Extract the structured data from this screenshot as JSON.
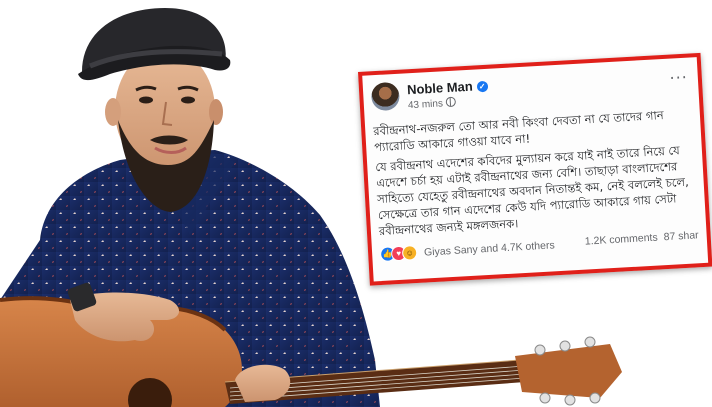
{
  "post": {
    "author": "Noble Man",
    "time": "43 mins",
    "more_icon": "more-horizontal-icon",
    "paragraph_1": "রবীন্দ্রনাথ-নজরুল তো আর নবী কিংবা দেবতা না যে তাদের গান প্যারোডি আকারে গাওয়া যাবে না!",
    "paragraph_2": "যে রবীন্দ্রনাথ এদেশের কবিদের মুল্যায়ন করে যাই নাই তারে নিয়ে যে এদেশে চর্চা হয় এটাই রবীন্দ্রনাথের জন্য বেশি। তাছাড়া বাংলাদেশের সাহিত্যে যেহেতু রবীন্দ্রনাথের অবদান নিতান্তই কম, নেই বললেই চলে, সেক্ষেত্রে তার গান এদেশের কেউ যদি প্যারোডি আকারে গায় সেটা রবীন্দ্রনাথের জন্যই মঙ্গলজনক।",
    "reaction_names": "Giyas Sany and 4.7K others",
    "comments": "1.2K comments",
    "shares": "87 shar",
    "colors": {
      "frame": "#e0201a",
      "link": "#1877f2"
    }
  },
  "photo": {
    "subject": "man with beard in black hat and blue patterned shirt holding acoustic guitar"
  }
}
